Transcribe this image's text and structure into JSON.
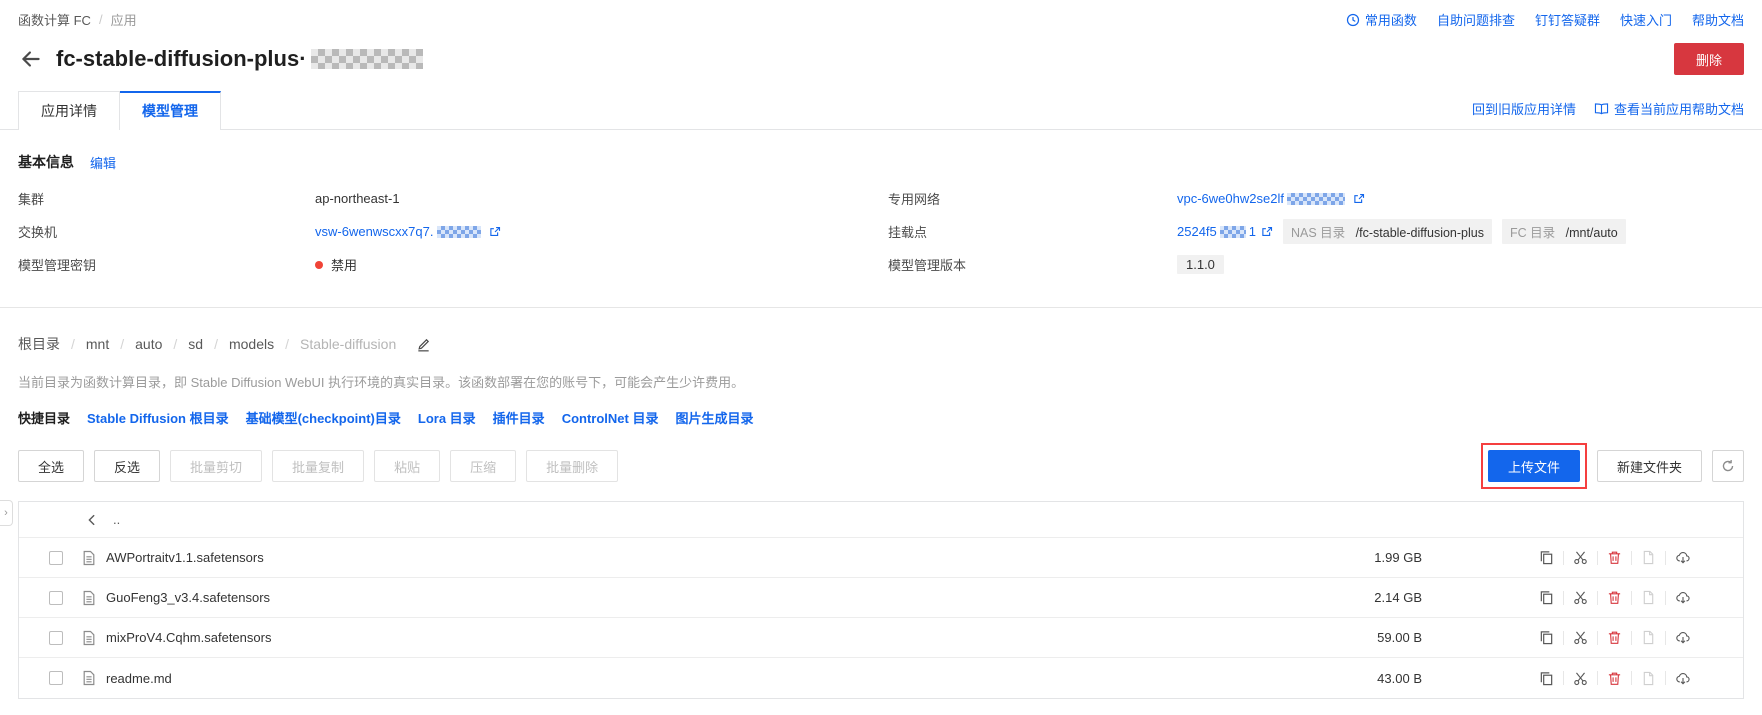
{
  "colors": {
    "accent": "#1366ec",
    "danger": "#d7373f",
    "annotation_box": "#f53f3f",
    "status_disabled_dot": "#f04437"
  },
  "topbar": {
    "breadcrumb": [
      "函数计算 FC",
      "应用"
    ],
    "links": [
      "常用函数",
      "自助问题排查",
      "钉钉答疑群",
      "快速入门",
      "帮助文档"
    ]
  },
  "header": {
    "title": "fc-stable-diffusion-plus·",
    "delete_label": "删除"
  },
  "tabs": [
    {
      "label": "应用详情"
    },
    {
      "label": "模型管理"
    }
  ],
  "tab_links": {
    "old_version": "回到旧版应用详情",
    "help_doc": "查看当前应用帮助文档"
  },
  "basic_info": {
    "title": "基本信息",
    "edit_label": "编辑",
    "cluster": {
      "label": "集群",
      "value": "ap-northeast-1"
    },
    "vpc": {
      "label": "专用网络",
      "value": "vpc-6we0hw2se2lf"
    },
    "vswitch": {
      "label": "交换机",
      "value": "vsw-6wenwscxx7q7."
    },
    "mount": {
      "label": "挂载点",
      "value_prefix": "2524f5",
      "value_suffix": "1",
      "nas_tag": {
        "label": "NAS 目录",
        "path": "/fc-stable-diffusion-plus"
      },
      "fc_tag": {
        "label": "FC 目录",
        "path": "/mnt/auto"
      }
    },
    "key": {
      "label": "模型管理密钥",
      "value": "禁用"
    },
    "version": {
      "label": "模型管理版本",
      "value": "1.1.0"
    }
  },
  "directory": {
    "breadcrumb": [
      "根目录",
      "mnt",
      "auto",
      "sd",
      "models",
      "Stable-diffusion"
    ],
    "note": "当前目录为函数计算目录，即 Stable Diffusion WebUI 执行环境的真实目录。该函数部署在您的账号下，可能会产生少许费用。",
    "shortcuts_label": "快捷目录",
    "shortcuts": [
      "Stable Diffusion 根目录",
      "基础模型(checkpoint)目录",
      "Lora 目录",
      "插件目录",
      "ControlNet 目录",
      "图片生成目录"
    ]
  },
  "toolbar": {
    "buttons": [
      "全选",
      "反选",
      "批量剪切",
      "批量复制",
      "粘贴",
      "压缩",
      "批量删除"
    ],
    "upload_label": "上传文件",
    "new_folder_label": "新建文件夹"
  },
  "file_table": {
    "parent_label": "..",
    "rows": [
      {
        "name": "AWPortraitv1.1.safetensors",
        "size": "1.99 GB"
      },
      {
        "name": "GuoFeng3_v3.4.safetensors",
        "size": "2.14 GB"
      },
      {
        "name": "mixProV4.Cqhm.safetensors",
        "size": "59.00 B"
      },
      {
        "name": "readme.md",
        "size": "43.00 B"
      }
    ]
  }
}
